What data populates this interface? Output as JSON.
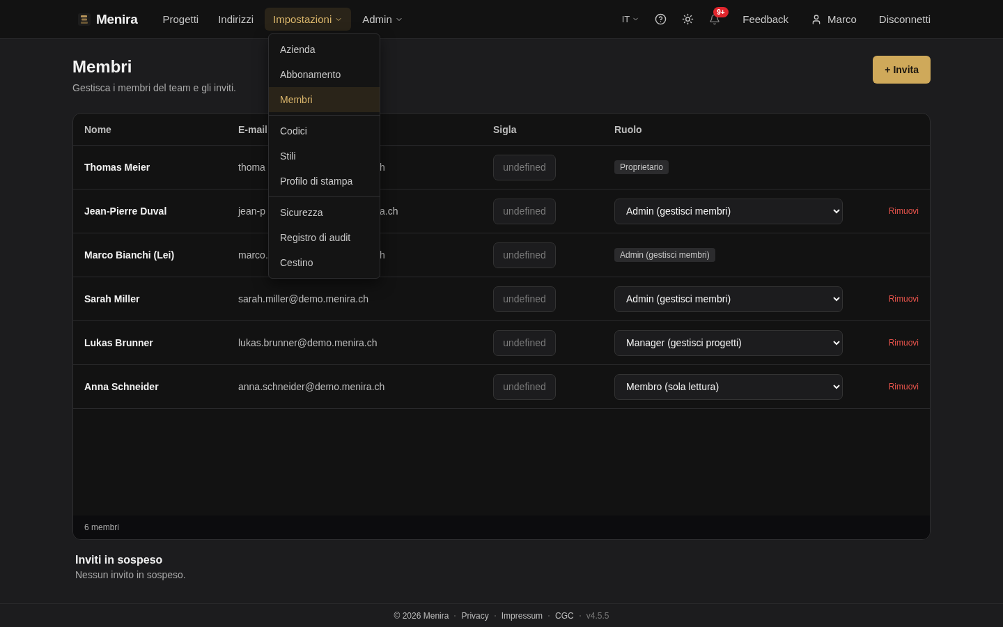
{
  "nav": {
    "brand": "Menira",
    "items": [
      {
        "label": "Progetti",
        "selected": false,
        "has_caret": false
      },
      {
        "label": "Indirizzi",
        "selected": false,
        "has_caret": false
      },
      {
        "label": "Impostazioni",
        "selected": true,
        "has_caret": true
      },
      {
        "label": "Admin",
        "selected": false,
        "has_caret": true
      }
    ],
    "language": "IT",
    "notification_badge": "9+",
    "feedback": "Feedback",
    "user": "Marco",
    "logout": "Disconnetti"
  },
  "menu": {
    "groups": [
      [
        {
          "label": "Azienda",
          "selected": false
        },
        {
          "label": "Abbonamento",
          "selected": false
        },
        {
          "label": "Membri",
          "selected": true
        }
      ],
      [
        {
          "label": "Codici",
          "selected": false
        },
        {
          "label": "Stili",
          "selected": false
        },
        {
          "label": "Profilo di stampa",
          "selected": false
        }
      ],
      [
        {
          "label": "Sicurezza",
          "selected": false
        },
        {
          "label": "Registro di audit",
          "selected": false
        },
        {
          "label": "Cestino",
          "selected": false
        }
      ]
    ]
  },
  "page": {
    "title": "Membri",
    "subtitle": "Gestisca i membri del team e gli inviti.",
    "invite_button": "+ Invita"
  },
  "table": {
    "columns": [
      "Nome",
      "E-mail",
      "Sigla",
      "Ruolo"
    ],
    "rows": [
      {
        "name": "Thomas Meier",
        "email_start": "thoma",
        "email_end": "h",
        "sigla_placeholder": "undefined",
        "role": {
          "kind": "badge",
          "label": "Proprietario"
        }
      },
      {
        "name": "Jean-Pierre Duval",
        "email_start": "jean-p",
        "email_end": "a.ch",
        "sigla_placeholder": "undefined",
        "role": {
          "kind": "select",
          "label": "Admin (gestisci membri)"
        },
        "remove": "Rimuovi"
      },
      {
        "name": "Marco Bianchi (Lei)",
        "email_start": "marco.",
        "email_end": "h",
        "sigla_placeholder": "undefined",
        "role": {
          "kind": "badge",
          "label": "Admin (gestisci membri)"
        }
      },
      {
        "name": "Sarah Miller",
        "email_start": "sarah.miller@demo.menira.ch",
        "sigla_placeholder": "undefined",
        "role": {
          "kind": "select",
          "label": "Admin (gestisci membri)"
        },
        "remove": "Rimuovi"
      },
      {
        "name": "Lukas Brunner",
        "email_start": "lukas.brunner@demo.menira.ch",
        "sigla_placeholder": "undefined",
        "role": {
          "kind": "select",
          "label": "Manager (gestisci progetti)"
        },
        "remove": "Rimuovi"
      },
      {
        "name": "Anna Schneider",
        "email_start": "anna.schneider@demo.menira.ch",
        "sigla_placeholder": "undefined",
        "role": {
          "kind": "select",
          "label": "Membro (sola lettura)"
        },
        "remove": "Rimuovi"
      }
    ],
    "footer": "6 membri"
  },
  "pending": {
    "title": "Inviti in sospeso",
    "text": "Nessun invito in sospeso."
  },
  "footer": {
    "copyright": "© 2026 Menira",
    "links": [
      "Privacy",
      "Impressum",
      "CGC"
    ],
    "version": "v4.5.5"
  }
}
